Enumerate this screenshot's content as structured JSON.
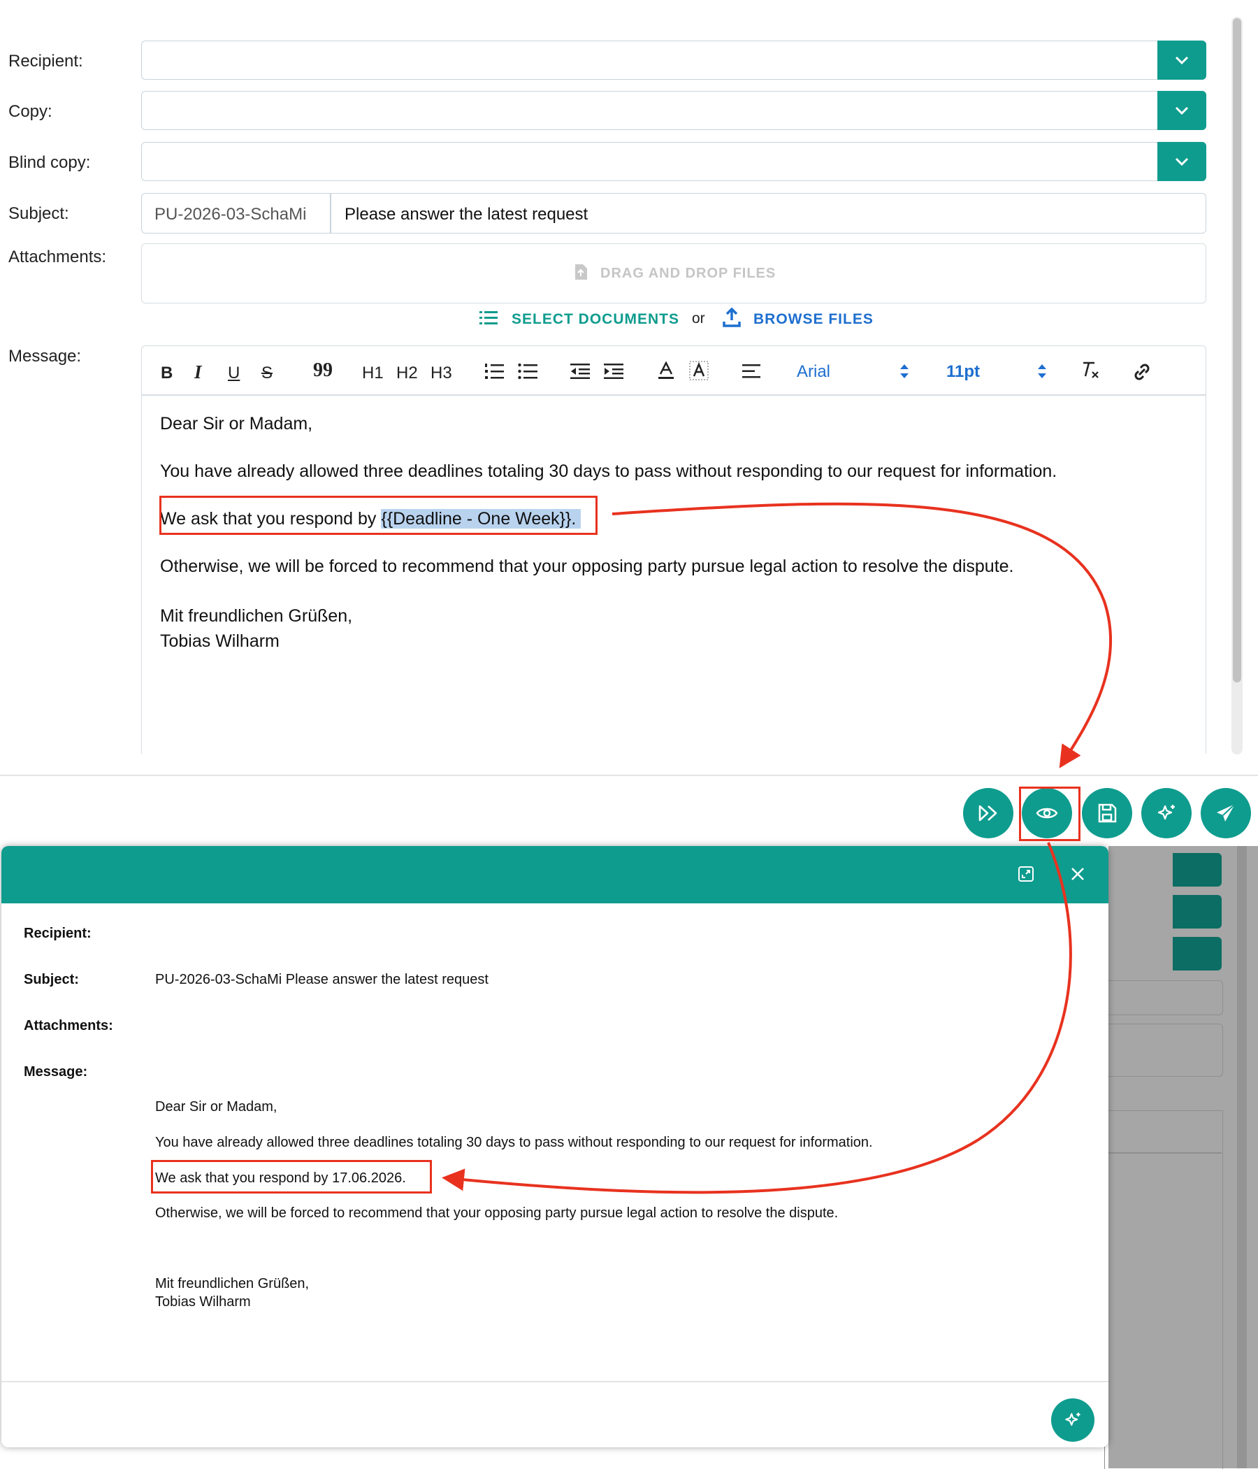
{
  "form": {
    "recipient_label": "Recipient:",
    "copy_label": "Copy:",
    "blind_copy_label": "Blind copy:",
    "subject_label": "Subject:",
    "subject_prefix": "PU-2026-03-SchaMi",
    "subject_text": "Please answer the latest request",
    "attachments_label": "Attachments:",
    "drop_text": "DRAG AND DROP FILES",
    "select_documents": "SELECT DOCUMENTS",
    "or": "or",
    "browse_files": "BROWSE FILES",
    "message_label": "Message:"
  },
  "toolbar": {
    "bold": "B",
    "italic": "I",
    "underline": "U",
    "strike": "S",
    "quote": "99",
    "h1": "H1",
    "h2": "H2",
    "h3": "H3",
    "font": "Arial",
    "size": "11pt"
  },
  "editor": {
    "line1": "Dear Sir or Madam,",
    "line2": "You have already allowed three deadlines totaling 30 days to pass without responding to our request for information.",
    "line3_prefix": "We ask that you respond by ",
    "line3_placeholder": "{{Deadline - One Week}}",
    "line3_suffix": ".",
    "line4": "Otherwise, we will be forced to recommend that your opposing party pursue legal action to resolve the dispute.",
    "line5": "Mit freundlichen Grüßen,",
    "line6": "Tobias Wilharm"
  },
  "preview": {
    "recipient_label": "Recipient:",
    "subject_label": "Subject:",
    "subject_value": "PU-2026-03-SchaMi Please answer the latest request",
    "attachments_label": "Attachments:",
    "message_label": "Message:",
    "line1": "Dear Sir or Madam,",
    "line2": "You have already allowed three deadlines totaling 30 days to pass without responding to our request for information.",
    "line3": "We ask that you respond by 17.06.2026.",
    "line4": "Otherwise, we will be forced to recommend that your opposing party pursue legal action to resolve the dispute.",
    "line5": "Mit freundlichen Grüßen,",
    "line6": "Tobias Wilharm"
  },
  "icons": {
    "dropdown": "chevron-down-icon",
    "actions": [
      "fast-forward-icon",
      "eye-icon",
      "save-icon",
      "sparkle-icon",
      "send-icon"
    ],
    "modal": [
      "expand-icon",
      "close-icon",
      "sparkle-icon"
    ]
  },
  "colors": {
    "accent": "#0e9c8e",
    "annotation": "#e8321f",
    "link_blue": "#1e6fcf",
    "highlight": "#b9d3ef"
  }
}
